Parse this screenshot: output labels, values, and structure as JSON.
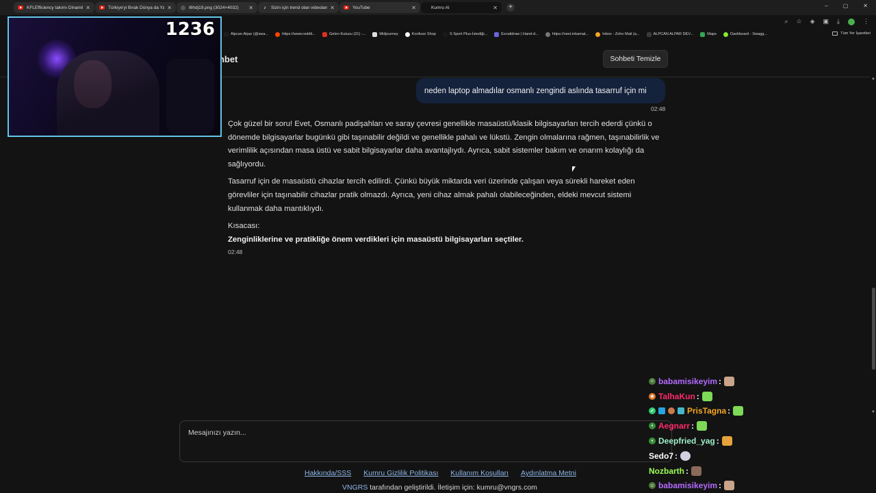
{
  "browser": {
    "tabs": [
      {
        "label": "KFLEfficiency takımı Dinamik S",
        "icon": "youtube-icon"
      },
      {
        "label": "Türkiye'yi Bırak Dünya da Yapa",
        "icon": "youtube-icon"
      },
      {
        "label": "t6hdj19.png (3024×4032)",
        "icon": "image-icon"
      },
      {
        "label": "Sizin için trend olan videoları",
        "icon": "tiktok-icon"
      },
      {
        "label": "YouTube",
        "icon": "youtube-icon"
      },
      {
        "label": "Kumru AI",
        "icon": "none",
        "active": true
      }
    ],
    "new_tab": "+",
    "window_controls": [
      "–",
      "▢",
      "✕"
    ],
    "bookmarks": [
      {
        "label": "Alpcan Alpar (@swa...",
        "color": "#1d1d1d"
      },
      {
        "label": "https://www.reddit...",
        "color": "#ff4500"
      },
      {
        "label": "Gelen Kutusu (31) -...",
        "color": "#d93025"
      },
      {
        "label": "Midjourney",
        "color": "#dddddd"
      },
      {
        "label": "Konfuse Shop",
        "color": "#ffffff"
      },
      {
        "label": "S Sport Plus-İstediği...",
        "color": "#1a1a1a"
      },
      {
        "label": "Excalidraw | Hand-d...",
        "color": "#6965db"
      },
      {
        "label": "https://next.inkamat...",
        "color": "#777777"
      },
      {
        "label": "Inbox - Zoho Mail (a...",
        "color": "#f5a623"
      },
      {
        "label": "ALPCAN ALPAR DEV...",
        "color": "#3a3a3a"
      },
      {
        "label": "Maps",
        "color": "#34a853"
      },
      {
        "label": "Dashboard - Swagg...",
        "color": "#85ea2d"
      }
    ],
    "all_bookmarks": "Tüm Yer İşaretleri"
  },
  "chat": {
    "title": "bhbet",
    "clear_button": "Sohbeti Temizle",
    "user_message": "neden laptop almadılar osmanlı zengindi aslında tasarruf için mi",
    "user_time": "02:48",
    "ai_paragraphs": [
      "Çok güzel bir soru! Evet, Osmanlı padişahları ve saray çevresi genellikle masaüstü/klasik bilgisayarları tercih ederdi çünkü o dönemde bilgisayarlar bugünkü gibi taşınabilir değildi ve genellikle pahalı ve lükstü. Zengin olmalarına rağmen, taşınabilirlik ve verimlilik açısından masa üstü ve sabit bilgisayarlar daha avantajlıydı. Ayrıca, sabit sistemler bakım ve onarım kolaylığı da sağlıyordu.",
      "Tasarruf için de masaüstü cihazlar tercih edilirdi. Çünkü büyük miktarda veri üzerinde çalışan veya sürekli hareket eden görevliler için taşınabilir cihazlar pratik olmazdı. Ayrıca, yeni cihaz almak pahalı olabileceğinden, eldeki mevcut sistemi kullanmak daha mantıklıydı."
    ],
    "summary_label": "Kısacası:",
    "summary_text": "Zenginliklerine ve pratikliğe önem verdikleri için masaüstü bilgisayarları seçtiler.",
    "ai_time": "02:48",
    "input_placeholder": "Mesajınızı yazın..."
  },
  "footer": {
    "links": [
      "Hakkında/SSS",
      "Kumru Gizlilik Politikası",
      "Kullanım Koşulları",
      "Aydınlatma Metni"
    ],
    "brand": "VNGRS",
    "note": " tarafından geliştirildi. İletişim için: kumru@vngrs.com"
  },
  "stream_overlay": {
    "counter": "1236",
    "chat": [
      {
        "user": "babamisikeyim",
        "color": "#b36bff",
        "badge": "#4a7a3a"
      },
      {
        "user": "TalhaKun",
        "color": "#ff2a6d",
        "badge": "#e0782b"
      },
      {
        "user": "PrisTagna",
        "color": "#f5a623",
        "badge": "#2ecc71"
      },
      {
        "user": "Aegnarr",
        "color": "#ff2a6d",
        "badge": "#3a8f3a"
      },
      {
        "user": "Deepfried_yag",
        "color": "#9ef0c8",
        "badge": "#3a8f3a"
      },
      {
        "user": "Sedo7",
        "color": "#ffffff",
        "badge": ""
      },
      {
        "user": "Nozbarth",
        "color": "#9cff57",
        "badge": ""
      },
      {
        "user": "babamisikeyim",
        "color": "#b36bff",
        "badge": "#4a7a3a"
      }
    ],
    "colon": ":"
  }
}
